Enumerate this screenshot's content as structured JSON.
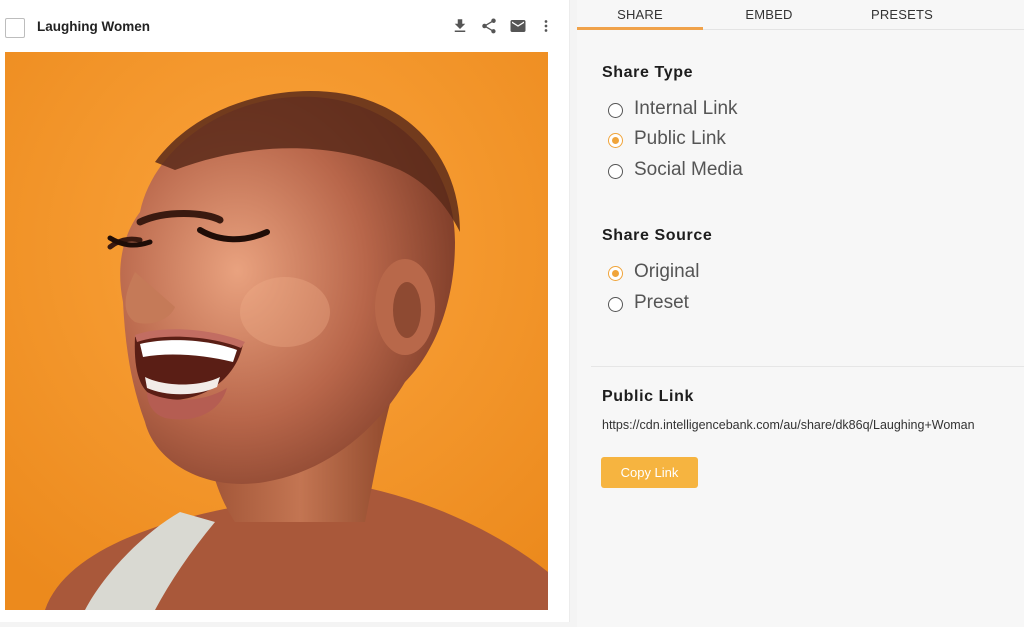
{
  "asset": {
    "title": "Laughing Women",
    "actions": [
      {
        "name": "download-icon"
      },
      {
        "name": "share-icon"
      },
      {
        "name": "mail-icon"
      },
      {
        "name": "more-vertical-icon"
      }
    ]
  },
  "tabs": [
    {
      "label": "SHARE",
      "active": true
    },
    {
      "label": "EMBED",
      "active": false
    },
    {
      "label": "PRESETS",
      "active": false
    }
  ],
  "share_type": {
    "title": "Share Type",
    "options": [
      {
        "label": "Internal Link",
        "checked": false
      },
      {
        "label": "Public Link",
        "checked": true
      },
      {
        "label": "Social Media",
        "checked": false
      }
    ]
  },
  "share_source": {
    "title": "Share Source",
    "options": [
      {
        "label": "Original",
        "checked": true
      },
      {
        "label": "Preset",
        "checked": false
      }
    ]
  },
  "public_link": {
    "title": "Public Link",
    "url": "https://cdn.intelligencebank.com/au/share/dk86q/Laughing+Woman",
    "copy_label": "Copy Link"
  },
  "colors": {
    "accent": "#f0a24a",
    "button": "#f6b440",
    "image_background": "#f39a2a"
  }
}
